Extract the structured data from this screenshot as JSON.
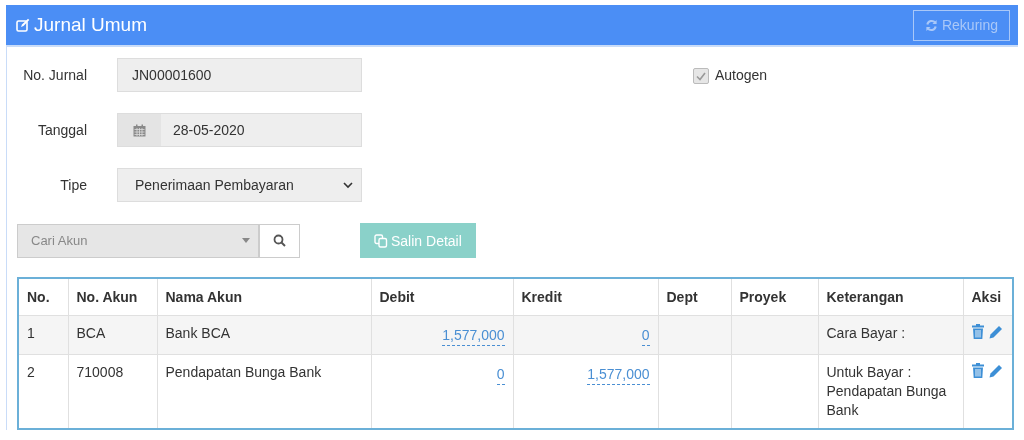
{
  "header": {
    "title": "Jurnal Umum",
    "rekuring_button": {
      "label": "Rekuring",
      "disabled": true
    }
  },
  "form": {
    "no_jurnal": {
      "label": "No. Jurnal",
      "value": "JN00001600"
    },
    "tanggal": {
      "label": "Tanggal",
      "value": "28-05-2020"
    },
    "tipe": {
      "label": "Tipe",
      "value": "Penerimaan Pembayaran"
    },
    "autogen": {
      "label": "Autogen",
      "checked": true,
      "disabled": true
    }
  },
  "account_search": {
    "placeholder": "Cari Akun"
  },
  "salin_button": {
    "label": "Salin Detail",
    "disabled": true
  },
  "table": {
    "columns": [
      "No.",
      "No. Akun",
      "Nama Akun",
      "Debit",
      "Kredit",
      "Dept",
      "Proyek",
      "Keterangan",
      "Aksi"
    ],
    "rows": [
      {
        "no": "1",
        "no_akun": "BCA",
        "nama_akun": "Bank BCA",
        "debit": "1,577,000",
        "kredit": "0",
        "dept": "",
        "proyek": "",
        "keterangan": "Cara Bayar :"
      },
      {
        "no": "2",
        "no_akun": "710008",
        "nama_akun": "Pendapatan Bunga Bank",
        "debit": "0",
        "kredit": "1,577,000",
        "dept": "",
        "proyek": "",
        "keterangan": "Untuk Bayar : Pendapatan Bunga Bank"
      }
    ]
  }
}
